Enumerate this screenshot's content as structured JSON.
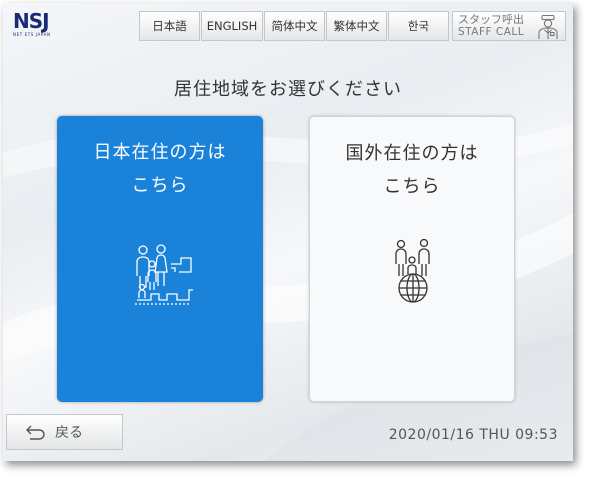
{
  "logo": {
    "mark": "NSJ",
    "subtitle": "NET ETS JAPAN"
  },
  "languages": [
    "日本語",
    "ENGLISH",
    "简体中文",
    "繁体中文",
    "한국"
  ],
  "staff_call": {
    "label_jp": "スタッフ呼出",
    "label_en": "STAFF CALL",
    "icon": "staff-person-icon"
  },
  "title": "居住地域をお選びください",
  "options": [
    {
      "line1": "日本在住の方は",
      "line2": "こちら",
      "icon": "family-house-icon",
      "color": "#1b82d9",
      "selected": true
    },
    {
      "line1": "国外在住の方は",
      "line2": "こちら",
      "icon": "family-globe-icon",
      "color": "#f8f9fa",
      "selected": false
    }
  ],
  "back": {
    "label": "戻る",
    "icon": "back-arrow-icon"
  },
  "datetime": "2020/01/16 THU 09:53"
}
